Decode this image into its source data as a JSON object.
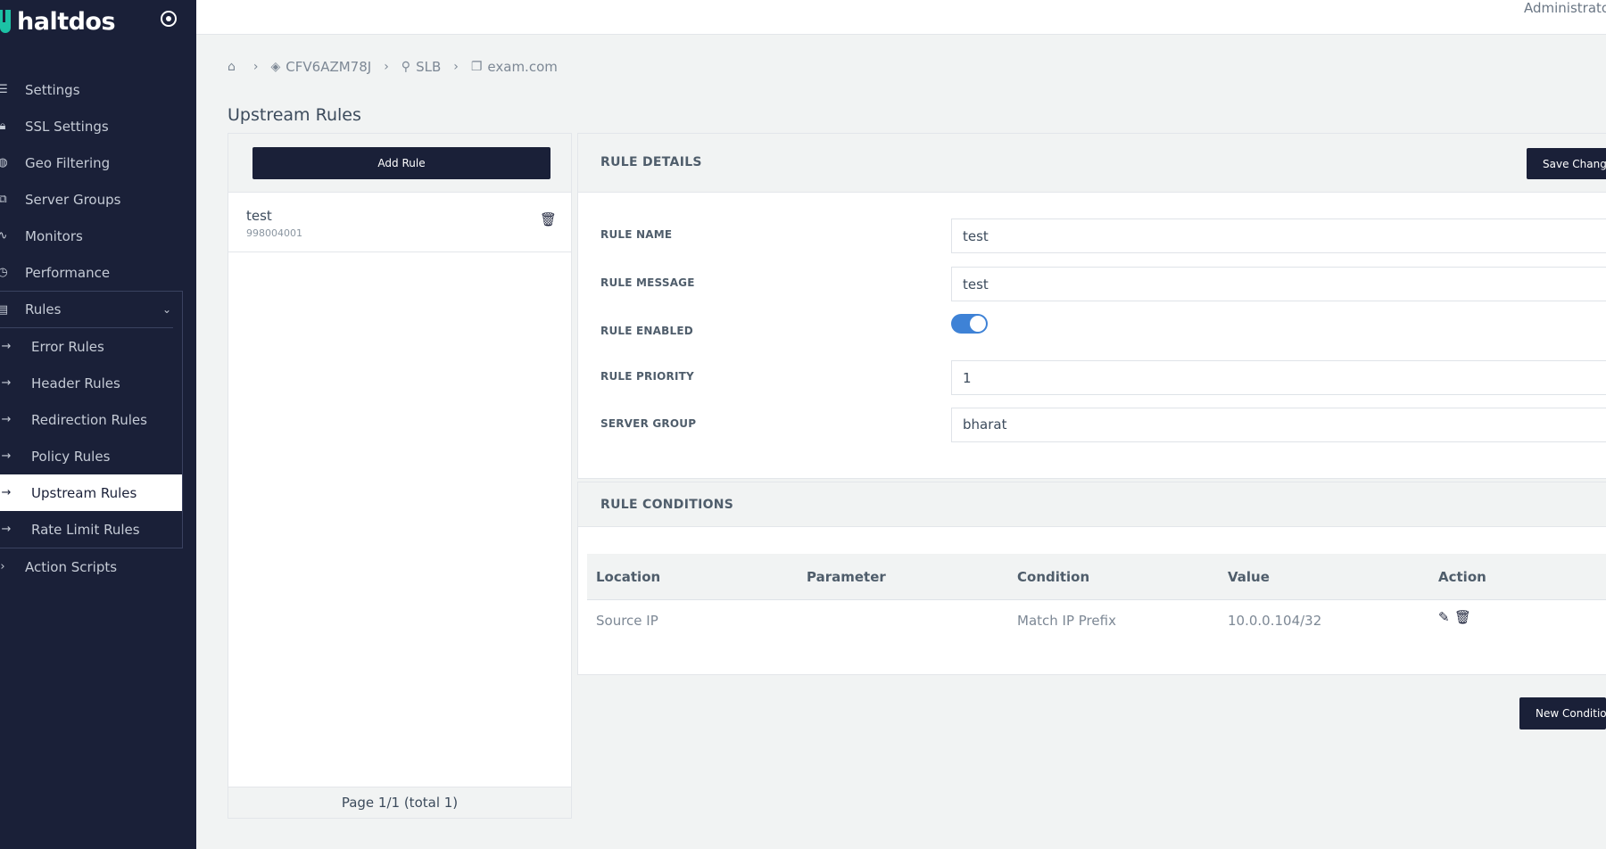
{
  "brand": {
    "name": "haltdos"
  },
  "topbar": {
    "user": "Administrator"
  },
  "sidebar": {
    "items": [
      {
        "label": "Settings",
        "icon": "sliders-icon"
      },
      {
        "label": "SSL Settings",
        "icon": "lock-icon"
      },
      {
        "label": "Geo Filtering",
        "icon": "globe-icon"
      },
      {
        "label": "Server Groups",
        "icon": "server-icon"
      },
      {
        "label": "Monitors",
        "icon": "pulse-icon"
      },
      {
        "label": "Performance",
        "icon": "stopwatch-icon"
      }
    ],
    "rules": {
      "label": "Rules",
      "icon": "list-icon",
      "children": [
        {
          "label": "Error Rules"
        },
        {
          "label": "Header Rules"
        },
        {
          "label": "Redirection Rules"
        },
        {
          "label": "Policy Rules"
        },
        {
          "label": "Upstream Rules",
          "active": true
        },
        {
          "label": "Rate Limit Rules"
        }
      ]
    },
    "action_scripts": {
      "label": "Action Scripts",
      "icon": "code-icon"
    }
  },
  "breadcrumb": {
    "items": [
      {
        "label": "CFV6AZM78J",
        "icon": "layers-icon"
      },
      {
        "label": "SLB",
        "icon": "sitemap-icon"
      },
      {
        "label": "exam.com",
        "icon": "window-icon"
      }
    ]
  },
  "page": {
    "title": "Upstream Rules"
  },
  "rule_list": {
    "add_button": "Add Rule",
    "items": [
      {
        "name": "test",
        "id": "998004001"
      }
    ],
    "footer": "Page 1/1 (total 1)"
  },
  "rule_details": {
    "title": "RULE DETAILS",
    "save_button": "Save Changes",
    "fields": {
      "name_label": "RULE NAME",
      "name_value": "test",
      "message_label": "RULE MESSAGE",
      "message_value": "test",
      "enabled_label": "RULE ENABLED",
      "enabled": true,
      "priority_label": "RULE PRIORITY",
      "priority_value": "1",
      "server_group_label": "SERVER GROUP",
      "server_group_value": "bharat"
    }
  },
  "rule_conditions": {
    "title": "RULE CONDITIONS",
    "columns": [
      "Location",
      "Parameter",
      "Condition",
      "Value",
      "Action"
    ],
    "rows": [
      {
        "location": "Source IP",
        "parameter": "",
        "condition": "Match IP Prefix",
        "value": "10.0.0.104/32"
      }
    ],
    "new_button": "New Condition"
  },
  "colors": {
    "sidebar_bg": "#1a2038",
    "accent": "#3e82d6",
    "brand": "#1cc2a5"
  }
}
